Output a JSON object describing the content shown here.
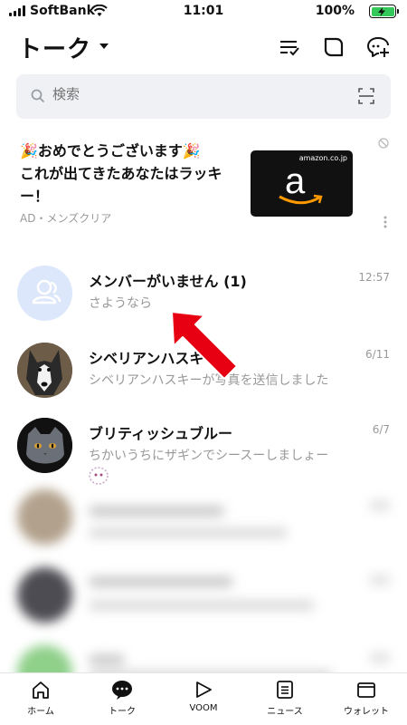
{
  "status_bar": {
    "carrier": "SoftBank",
    "time": "11:01",
    "battery": "100%"
  },
  "header": {
    "title": "トーク"
  },
  "search": {
    "placeholder": "検索"
  },
  "ad": {
    "line1": "🎉おめでとうございます🎉",
    "line2": "これが出てきたあなたはラッキー！",
    "label": "AD・メンズクリア",
    "card_domain": "amazon.co.jp",
    "card_logo": "a"
  },
  "chats": [
    {
      "name": "メンバーがいません (1)",
      "preview": "さようなら",
      "date": "12:57"
    },
    {
      "name": "シベリアンハスキー",
      "preview": "シベリアンハスキーが写真を送信しました",
      "date": "6/11"
    },
    {
      "name": "ブリティッシュブルー",
      "preview": "ちかいうちにザギンでシースーしましょー",
      "date": "6/7"
    }
  ],
  "nav": [
    {
      "label": "ホーム",
      "icon": "home-icon"
    },
    {
      "label": "トーク",
      "icon": "chat-bubble-icon"
    },
    {
      "label": "VOOM",
      "icon": "voom-play-icon"
    },
    {
      "label": "ニュース",
      "icon": "news-icon"
    },
    {
      "label": "ウォレット",
      "icon": "wallet-icon"
    }
  ],
  "colors": {
    "battery": "#34c759",
    "arrow": "#e60012",
    "empty_avatar": "#dde7fb"
  }
}
